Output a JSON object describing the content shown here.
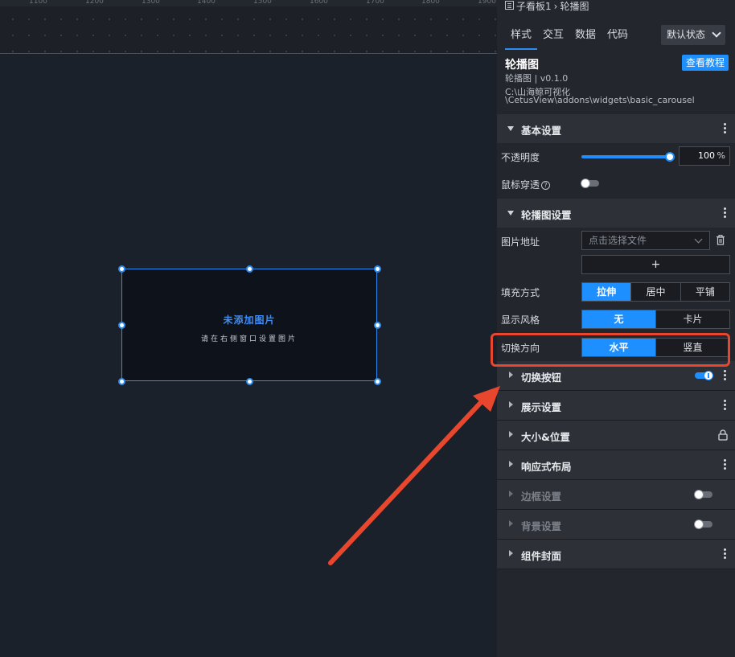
{
  "ruler": {
    "ticks": [
      "1100",
      "1200",
      "1300",
      "1400",
      "1500",
      "1600",
      "1700",
      "1800",
      "1900"
    ]
  },
  "widget": {
    "placeholder_title": "未添加图片",
    "placeholder_subtitle": "请在右侧窗口设置图片"
  },
  "breadcrumb": {
    "parent": "子看板1",
    "separator": "›",
    "current": "轮播图"
  },
  "tabs": [
    {
      "label": "样式"
    },
    {
      "label": "交互"
    },
    {
      "label": "数据"
    },
    {
      "label": "代码"
    }
  ],
  "state_select": {
    "value": "默认状态"
  },
  "info": {
    "name": "轮播图",
    "version": "轮播图 | v0.1.0",
    "path_line1": "C:\\山海鲸可视化",
    "path_line2": "\\CetusView\\addons\\widgets\\basic_carousel",
    "tutorial_label": "查看教程"
  },
  "sections": {
    "basic": {
      "title": "基本设置"
    },
    "carousel": {
      "title": "轮播图设置"
    },
    "switch_button": {
      "title": "切换按钮"
    },
    "display": {
      "title": "展示设置"
    },
    "size_position": {
      "title": "大小&位置"
    },
    "responsive": {
      "title": "响应式布局"
    },
    "border": {
      "title": "边框设置"
    },
    "background": {
      "title": "背景设置"
    },
    "cover": {
      "title": "组件封面"
    }
  },
  "props": {
    "opacity": {
      "label": "不透明度",
      "value": "100",
      "unit": "%",
      "level": 1.0
    },
    "mouse_through": {
      "label": "鼠标穿透",
      "help": "?",
      "on": false
    },
    "image_url": {
      "label": "图片地址",
      "placeholder": "点击选择文件",
      "add_label": "+"
    },
    "fill_mode": {
      "label": "填充方式",
      "options": [
        "拉伸",
        "居中",
        "平铺"
      ],
      "selected": "拉伸"
    },
    "display_style": {
      "label": "显示风格",
      "options": [
        "无",
        "卡片"
      ],
      "selected": "无"
    },
    "switch_direction": {
      "label": "切换方向",
      "options": [
        "水平",
        "竖直"
      ],
      "selected": "水平"
    }
  },
  "colors": {
    "accent": "#1e8fff",
    "annotation": "#e8472e",
    "panel_bg": "#23262c",
    "canvas_bg": "#1b212a"
  }
}
